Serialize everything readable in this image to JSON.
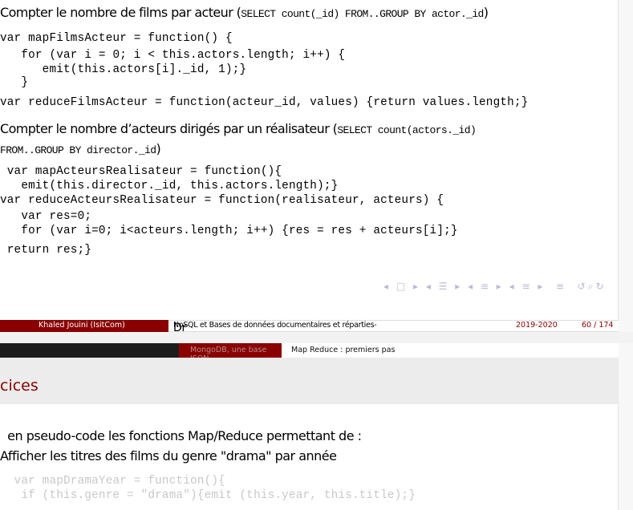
{
  "slide1": {
    "heading1_text": "Compter le nombre de films par acteur (",
    "heading1_code": "SELECT count(_id) FROM..GROUP BY actor._id",
    "heading1_close": ")",
    "code1": [
      "var mapFilmsActeur = function() {",
      "   for (var i = 0; i < this.actors.length; i++) {",
      "      emit(this.actors[i]._id, 1);}",
      "   }",
      "var reduceFilmsActeur = function(acteur_id, values) {return values.length;}"
    ],
    "heading2_text": "Compter le nombre d’acteurs dirigés par un réalisateur (",
    "heading2_code": "SELECT count(actors._id)",
    "heading2_line2_code": "FROM..GROUP BY director._id",
    "heading2_close": ")",
    "code2": [
      " var mapActeursRealisateur = function(){",
      "   emit(this.director._id, this.actors.length);}",
      "var reduceActeursRealisateur = function(realisateur, acteurs) {",
      "   var res=0;",
      "   for (var i=0; i<acteurs.length; i++) {res = res + acteurs[i];}",
      " return res;}"
    ],
    "nav_symbols": "◂ □ ▸ ◂ ☰ ▸ ◂ ≡ ▸ ◂ ≡ ▸  ≡  ↺⌕↻"
  },
  "footer": {
    "author": "Khaled Jouini  (IsitCom)",
    "title": "NoSQL et Bases de données documentaires et réparties- ",
    "title_suffix": "Dr",
    "year": "2019-2020",
    "page": "60 / 174"
  },
  "section_header": {
    "section": "MongoDB, une base JSON",
    "subsection": "Map Reduce : premiers pas"
  },
  "slide2": {
    "frame_title": "cices",
    "line1": "  en pseudo-code les fonctions Map/Reduce permettant de :",
    "line2": "Afficher les titres des films du genre \"drama\" par année",
    "faded_code": [
      "  var mapDramaYear = function(){",
      "   if (this.genre = \"drama\"){emit (this.year, this.title);}"
    ]
  }
}
